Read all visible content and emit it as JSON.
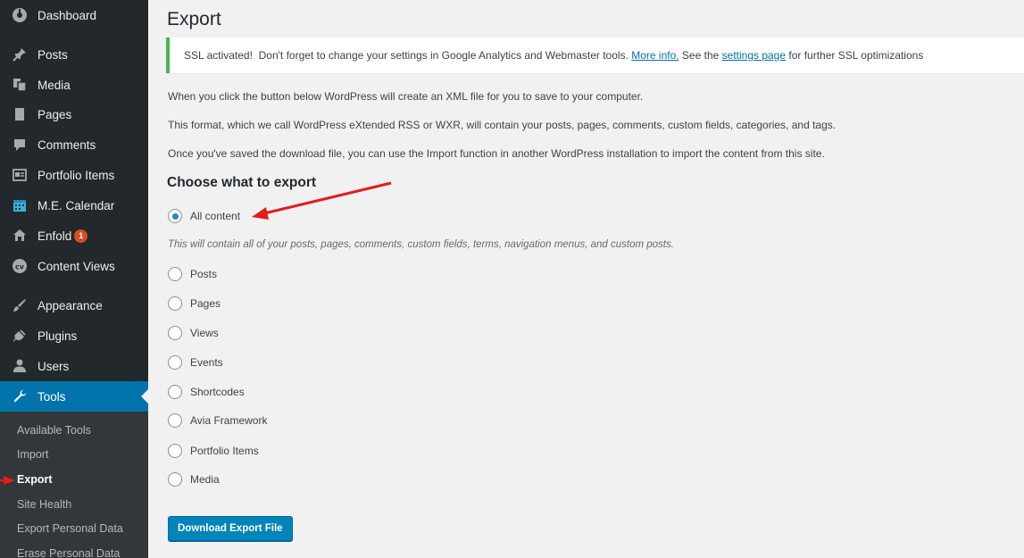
{
  "sidebar": {
    "items": [
      {
        "label": "Dashboard",
        "icon": "dashboard-icon"
      },
      {
        "label": "Posts",
        "icon": "pin-icon"
      },
      {
        "label": "Media",
        "icon": "media-icon"
      },
      {
        "label": "Pages",
        "icon": "page-icon"
      },
      {
        "label": "Comments",
        "icon": "comment-icon"
      },
      {
        "label": "Portfolio Items",
        "icon": "portfolio-icon"
      },
      {
        "label": "M.E. Calendar",
        "icon": "calendar-icon"
      },
      {
        "label": "Enfold",
        "icon": "home-icon",
        "badge": "1"
      },
      {
        "label": "Content Views",
        "icon": "content-views-icon"
      },
      {
        "label": "Appearance",
        "icon": "brush-icon"
      },
      {
        "label": "Plugins",
        "icon": "plugin-icon"
      },
      {
        "label": "Users",
        "icon": "users-icon"
      },
      {
        "label": "Tools",
        "icon": "wrench-icon"
      }
    ],
    "submenu": [
      "Available Tools",
      "Import",
      "Export",
      "Site Health",
      "Export Personal Data",
      "Erase Personal Data"
    ]
  },
  "page": {
    "title": "Export",
    "notice": {
      "text_before": "SSL activated!  Don't forget to change your settings in Google Analytics and Webmaster tools. ",
      "link1": "More info.",
      "text_middle": " See the ",
      "link2": "settings page",
      "text_after": " for further SSL optimizations"
    },
    "paragraphs": [
      "When you click the button below WordPress will create an XML file for you to save to your computer.",
      "This format, which we call WordPress eXtended RSS or WXR, will contain your posts, pages, comments, custom fields, categories, and tags.",
      "Once you've saved the download file, you can use the Import function in another WordPress installation to import the content from this site."
    ],
    "section_heading": "Choose what to export",
    "options": [
      "All content",
      "Posts",
      "Pages",
      "Views",
      "Events",
      "Shortcodes",
      "Avia Framework",
      "Portfolio Items",
      "Media"
    ],
    "selected_option": "All content",
    "all_content_hint": "This will contain all of your posts, pages, comments, custom fields, terms, navigation menus, and custom posts.",
    "download_button": "Download Export File"
  },
  "colors": {
    "sidebar_bg": "#23282d",
    "accent": "#0073aa",
    "notice_border": "#46b450",
    "annotation_arrow": "#e51b1b"
  }
}
